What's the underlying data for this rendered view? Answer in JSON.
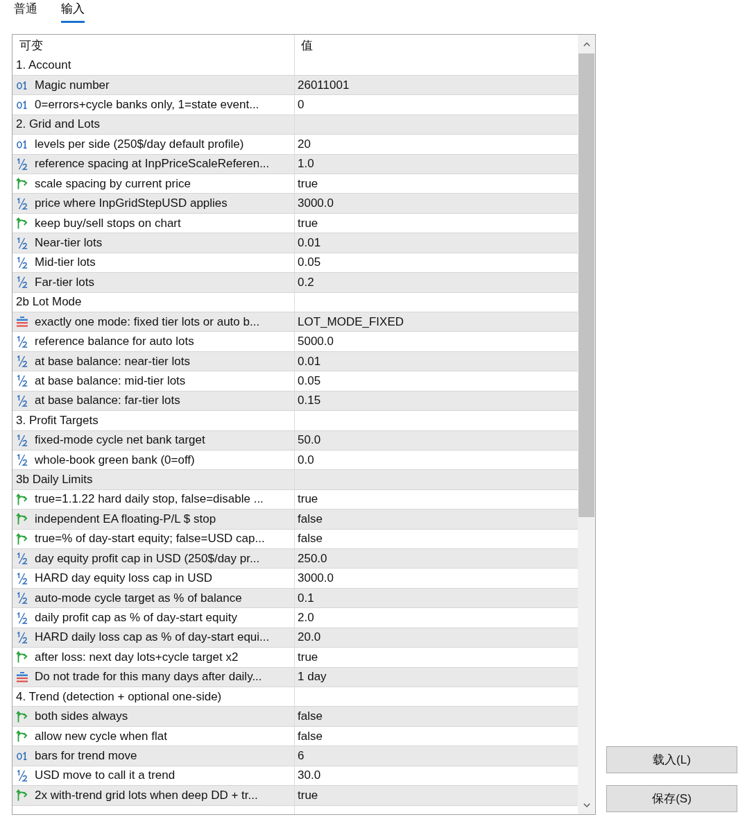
{
  "tabs": [
    {
      "label": "普通",
      "selected": false
    },
    {
      "label": "输入",
      "selected": true
    }
  ],
  "table": {
    "columns": [
      "可变",
      "值"
    ],
    "rows": [
      {
        "kind": "group",
        "name": "1. Account"
      },
      {
        "kind": "int",
        "name": "Magic number",
        "value": "26011001"
      },
      {
        "kind": "int",
        "name": "0=errors+cycle banks only, 1=state event...",
        "value": "0"
      },
      {
        "kind": "group",
        "name": "2. Grid and Lots"
      },
      {
        "kind": "int",
        "name": "levels per side (250$/day default profile)",
        "value": "20"
      },
      {
        "kind": "double",
        "name": "reference spacing at InpPriceScaleReferen...",
        "value": "1.0"
      },
      {
        "kind": "bool",
        "name": "scale spacing by current price",
        "value": "true"
      },
      {
        "kind": "double",
        "name": "price where InpGridStepUSD applies",
        "value": "3000.0"
      },
      {
        "kind": "bool",
        "name": "keep buy/sell stops on chart",
        "value": "true"
      },
      {
        "kind": "double",
        "name": "Near-tier lots",
        "value": "0.01"
      },
      {
        "kind": "double",
        "name": "Mid-tier lots",
        "value": "0.05"
      },
      {
        "kind": "double",
        "name": "Far-tier lots",
        "value": "0.2"
      },
      {
        "kind": "group",
        "name": "2b Lot Mode"
      },
      {
        "kind": "enum",
        "name": "exactly one mode: fixed tier lots or auto b...",
        "value": "LOT_MODE_FIXED"
      },
      {
        "kind": "double",
        "name": "reference balance for auto lots",
        "value": "5000.0"
      },
      {
        "kind": "double",
        "name": "at base balance: near-tier lots",
        "value": "0.01"
      },
      {
        "kind": "double",
        "name": "at base balance: mid-tier lots",
        "value": "0.05"
      },
      {
        "kind": "double",
        "name": "at base balance: far-tier lots",
        "value": "0.15"
      },
      {
        "kind": "group",
        "name": "3. Profit Targets"
      },
      {
        "kind": "double",
        "name": "fixed-mode cycle net bank target",
        "value": "50.0"
      },
      {
        "kind": "double",
        "name": "whole-book green bank (0=off)",
        "value": "0.0"
      },
      {
        "kind": "group",
        "name": "3b Daily Limits"
      },
      {
        "kind": "bool",
        "name": "true=1.1.22 hard daily stop, false=disable ...",
        "value": "true"
      },
      {
        "kind": "bool",
        "name": "independent EA floating-P/L $ stop",
        "value": "false"
      },
      {
        "kind": "bool",
        "name": "true=% of day-start equity; false=USD cap...",
        "value": "false"
      },
      {
        "kind": "double",
        "name": "day equity profit cap in USD (250$/day pr...",
        "value": "250.0"
      },
      {
        "kind": "double",
        "name": "HARD day equity loss cap in USD",
        "value": "3000.0"
      },
      {
        "kind": "double",
        "name": "auto-mode cycle target as % of balance",
        "value": "0.1"
      },
      {
        "kind": "double",
        "name": "daily profit cap as % of day-start equity",
        "value": "2.0"
      },
      {
        "kind": "double",
        "name": "HARD daily loss cap as % of day-start equi...",
        "value": "20.0"
      },
      {
        "kind": "bool",
        "name": "after loss: next day lots+cycle target x2",
        "value": "true"
      },
      {
        "kind": "enum",
        "name": "Do not trade for this many days after daily...",
        "value": "1 day"
      },
      {
        "kind": "group",
        "name": "4. Trend (detection + optional one-side)"
      },
      {
        "kind": "bool",
        "name": "both sides always",
        "value": "false"
      },
      {
        "kind": "bool",
        "name": "allow new cycle when flat",
        "value": "false"
      },
      {
        "kind": "int",
        "name": "bars for trend move",
        "value": "6"
      },
      {
        "kind": "double",
        "name": "USD move to call it a trend",
        "value": "30.0"
      },
      {
        "kind": "bool",
        "name": "2x with-trend grid lots when deep DD + tr...",
        "value": "true"
      }
    ]
  },
  "buttons": [
    "载入(L)",
    "保存(S)"
  ]
}
